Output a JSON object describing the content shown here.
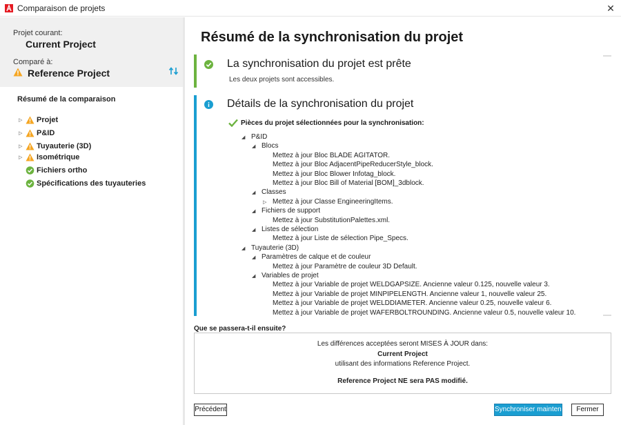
{
  "window": {
    "title": "Comparaison de projets",
    "close_glyph": "✕"
  },
  "left": {
    "current_label": "Projet courant:",
    "current_project": "Current Project",
    "compared_label": "Comparé à:",
    "reference_project": "Reference Project",
    "summary_title": "Résumé de la comparaison",
    "tree": [
      {
        "label": "Projet",
        "icon": "warning-icon",
        "expandable": true
      },
      {
        "label": "P&ID",
        "icon": "warning-icon",
        "expandable": true
      },
      {
        "label": "Tuyauterie (3D)",
        "icon": "warning-icon",
        "expandable": true
      },
      {
        "label": "Isométrique",
        "icon": "warning-icon",
        "expandable": true
      },
      {
        "label": "Fichiers ortho",
        "icon": "check-circle-icon",
        "expandable": false
      },
      {
        "label": "Spécifications des tuyauteries",
        "icon": "check-circle-icon",
        "expandable": false
      }
    ]
  },
  "main": {
    "title": "Résumé de la synchronisation du projet",
    "ready": {
      "heading": "La synchronisation du projet est prête",
      "sub": "Les deux projets sont accessibles."
    },
    "details": {
      "heading": "Détails de la synchronisation du projet",
      "selected": "Pièces du projet sélectionnées pour la synchronisation:",
      "lines": [
        {
          "level": 0,
          "tri": "◢",
          "text": "P&ID"
        },
        {
          "level": 1,
          "tri": "◢",
          "text": "Blocs"
        },
        {
          "level": 2,
          "tri": "",
          "text": "Mettez à jour Bloc BLADE AGITATOR."
        },
        {
          "level": 2,
          "tri": "",
          "text": "Mettez à jour Bloc AdjacentPipeReducerStyle_block."
        },
        {
          "level": 2,
          "tri": "",
          "text": "Mettez à jour Bloc Blower Infotag_block."
        },
        {
          "level": 2,
          "tri": "",
          "text": "Mettez à jour Bloc Bill of Material [BOM]_3dblock."
        },
        {
          "level": 1,
          "tri": "◢",
          "text": "Classes"
        },
        {
          "level": 2,
          "tri": "▷",
          "text": "Mettez à jour Classe EngineeringItems."
        },
        {
          "level": 1,
          "tri": "◢",
          "text": "Fichiers de support"
        },
        {
          "level": 2,
          "tri": "",
          "text": "Mettez à jour  SubstitutionPalettes.xml."
        },
        {
          "level": 1,
          "tri": "◢",
          "text": "Listes de sélection"
        },
        {
          "level": 2,
          "tri": "",
          "text": "Mettez à jour Liste de sélection Pipe_Specs."
        },
        {
          "level": 0,
          "tri": "◢",
          "text": "Tuyauterie (3D)"
        },
        {
          "level": 1,
          "tri": "◢",
          "text": "Paramètres de calque et de couleur"
        },
        {
          "level": 2,
          "tri": "",
          "text": "Mettez à jour Paramètre de couleur 3D Default."
        },
        {
          "level": 1,
          "tri": "◢",
          "text": "Variables de projet"
        },
        {
          "level": 2,
          "tri": "",
          "text": "Mettez à jour Variable de projet WELDGAPSIZE. Ancienne valeur 0.125, nouvelle valeur 3."
        },
        {
          "level": 2,
          "tri": "",
          "text": "Mettez à jour Variable de projet MINPIPELENGTH. Ancienne valeur 1, nouvelle valeur 25."
        },
        {
          "level": 2,
          "tri": "",
          "text": "Mettez à jour Variable de projet WELDDIAMETER. Ancienne valeur 0.25, nouvelle valeur 6."
        },
        {
          "level": 2,
          "tri": "",
          "text": "Mettez à jour Variable de projet WAFERBOLTROUNDING. Ancienne valeur 0.5, nouvelle valeur 10."
        }
      ]
    },
    "next": {
      "title": "Que se passera-t-il ensuite?",
      "line1": "Les différences acceptées seront MISES À JOUR dans:",
      "line2": "Current Project",
      "line3": "utilisant des informations Reference Project.",
      "line4": "Reference Project NE sera PAS modifié."
    },
    "buttons": {
      "previous": "Précédent",
      "sync": "Synchroniser maintenant",
      "close": "Fermer"
    }
  },
  "colors": {
    "accent_blue": "#1a9ed1",
    "success_green": "#6cb33f",
    "warning_orange": "#f5a623"
  }
}
